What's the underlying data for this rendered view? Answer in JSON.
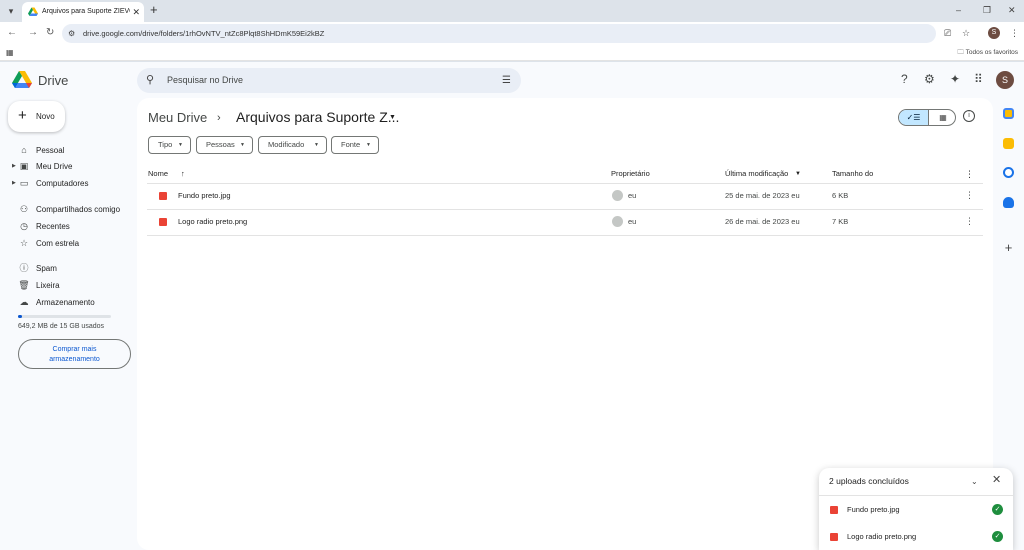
{
  "browser": {
    "tab_title": "Arquivos para Suporte ZIEVO -",
    "url": "drive.google.com/drive/folders/1rhOvNTV_ntZc8Plqt8ShHDmK59Ei2kBZ",
    "bookmarks_all": "Todos os favoritos",
    "profile_initial": "S"
  },
  "drive": {
    "app_name": "Drive",
    "search_placeholder": "Pesquisar no Drive",
    "avatar_initial": "S",
    "new_label": "Novo",
    "nav": {
      "pessoal": "Pessoal",
      "meu_drive": "Meu Drive",
      "computadores": "Computadores",
      "compartilhados": "Compartilhados comigo",
      "recentes": "Recentes",
      "com_estrela": "Com estrela",
      "spam": "Spam",
      "lixeira": "Lixeira",
      "armazenamento": "Armazenamento"
    },
    "storage": {
      "text": "649,2 MB de 15 GB usados",
      "fraction": 0.043,
      "buy_line1": "Comprar mais",
      "buy_line2": "armazenamento"
    },
    "breadcrumb": {
      "root": "Meu Drive",
      "current": "Arquivos para Suporte Z..."
    },
    "filters": {
      "tipo": "Tipo",
      "pessoas": "Pessoas",
      "modificado": "Modificado",
      "fonte": "Fonte"
    },
    "columns": {
      "name": "Nome",
      "owner": "Proprietário",
      "modified": "Última modificação",
      "size": "Tamanho do"
    },
    "files": [
      {
        "name": "Fundo preto.jpg",
        "owner": "eu",
        "modified": "25 de mai. de 2023 eu",
        "size": "6 KB"
      },
      {
        "name": "Logo radio preto.png",
        "owner": "eu",
        "modified": "26 de mai. de 2023 eu",
        "size": "7 KB"
      }
    ],
    "upload": {
      "title": "2 uploads concluídos",
      "items": [
        "Fundo preto.jpg",
        "Logo radio preto.png"
      ]
    },
    "colors": {
      "accent": "#0b57d0",
      "selected_toggle": "#c2e7ff",
      "image_file": "#ea4335",
      "success": "#1e8e3e"
    }
  }
}
